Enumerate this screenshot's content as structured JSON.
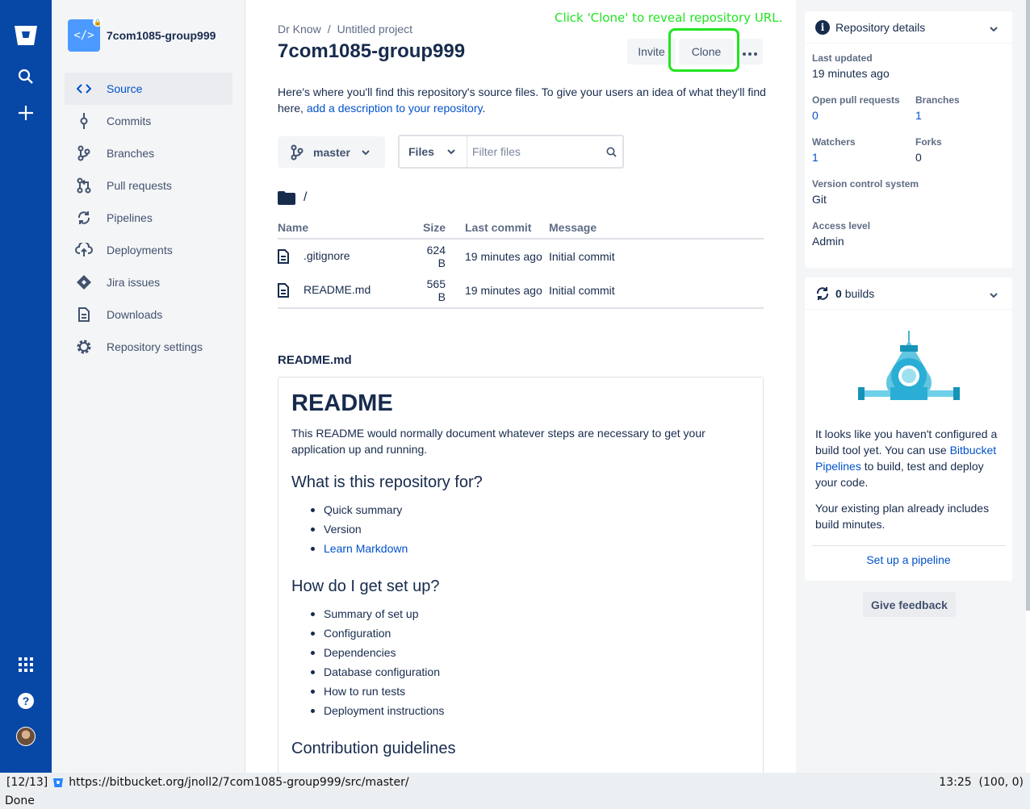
{
  "annotation": "Click 'Clone' to reveal repository URL.",
  "sidebar": {
    "repo_name": "7com1085-group999",
    "items": [
      {
        "label": "Source",
        "icon": "source-icon"
      },
      {
        "label": "Commits",
        "icon": "commit-icon"
      },
      {
        "label": "Branches",
        "icon": "branch-icon"
      },
      {
        "label": "Pull requests",
        "icon": "pull-request-icon"
      },
      {
        "label": "Pipelines",
        "icon": "pipelines-icon"
      },
      {
        "label": "Deployments",
        "icon": "deployments-icon"
      },
      {
        "label": "Jira issues",
        "icon": "jira-icon"
      },
      {
        "label": "Downloads",
        "icon": "downloads-icon"
      },
      {
        "label": "Repository settings",
        "icon": "settings-icon"
      }
    ]
  },
  "header": {
    "breadcrumb_owner": "Dr Know",
    "breadcrumb_sep": "/",
    "breadcrumb_project": "Untitled project",
    "title": "7com1085-group999",
    "invite_label": "Invite",
    "clone_label": "Clone"
  },
  "description": {
    "text": "Here's where you'll find this repository's source files. To give your users an idea of what they'll find here, ",
    "link": "add a description to your repository",
    "end": "."
  },
  "branch": {
    "name": "master"
  },
  "filter": {
    "files_label": "Files",
    "placeholder": "Filter files"
  },
  "path": "/",
  "files_table": {
    "headers": {
      "name": "Name",
      "size": "Size",
      "last_commit": "Last commit",
      "message": "Message"
    },
    "rows": [
      {
        "name": ".gitignore",
        "size": "624 B",
        "last_commit": "19 minutes ago",
        "message": "Initial commit"
      },
      {
        "name": "README.md",
        "size": "565 B",
        "last_commit": "19 minutes ago",
        "message": "Initial commit"
      }
    ]
  },
  "readme": {
    "label": "README.md",
    "h1": "README",
    "intro": "This README would normally document whatever steps are necessary to get your application up and running.",
    "h2_1": "What is this repository for?",
    "list1": [
      "Quick summary",
      "Version"
    ],
    "list1_link": "Learn Markdown",
    "h2_2": "How do I get set up?",
    "list2": [
      "Summary of set up",
      "Configuration",
      "Dependencies",
      "Database configuration",
      "How to run tests",
      "Deployment instructions"
    ],
    "h2_3": "Contribution guidelines"
  },
  "details": {
    "title": "Repository details",
    "last_updated_label": "Last updated",
    "last_updated": "19 minutes ago",
    "open_prs_label": "Open pull requests",
    "open_prs": "0",
    "branches_label": "Branches",
    "branches": "1",
    "watchers_label": "Watchers",
    "watchers": "1",
    "forks_label": "Forks",
    "forks": "0",
    "vcs_label": "Version control system",
    "vcs": "Git",
    "access_label": "Access level",
    "access": "Admin"
  },
  "builds": {
    "count": "0",
    "label": "builds",
    "text1": "It looks like you haven't configured a build tool yet. You can use ",
    "link": "Bitbucket Pipelines",
    "text2": " to build, test and deploy your code.",
    "text3": "Your existing plan already includes build minutes.",
    "setup_label": "Set up a pipeline"
  },
  "feedback_label": "Give feedback",
  "statusbar": {
    "tab_index": "[12/13]",
    "url": "https://bitbucket.org/jnoll2/7com1085-group999/src/master/",
    "time": "13:25",
    "coords": "(100, 0)",
    "status": "Done"
  },
  "colors": {
    "nav": "#0747a6",
    "link": "#0052cc",
    "annotation": "#21e521"
  }
}
